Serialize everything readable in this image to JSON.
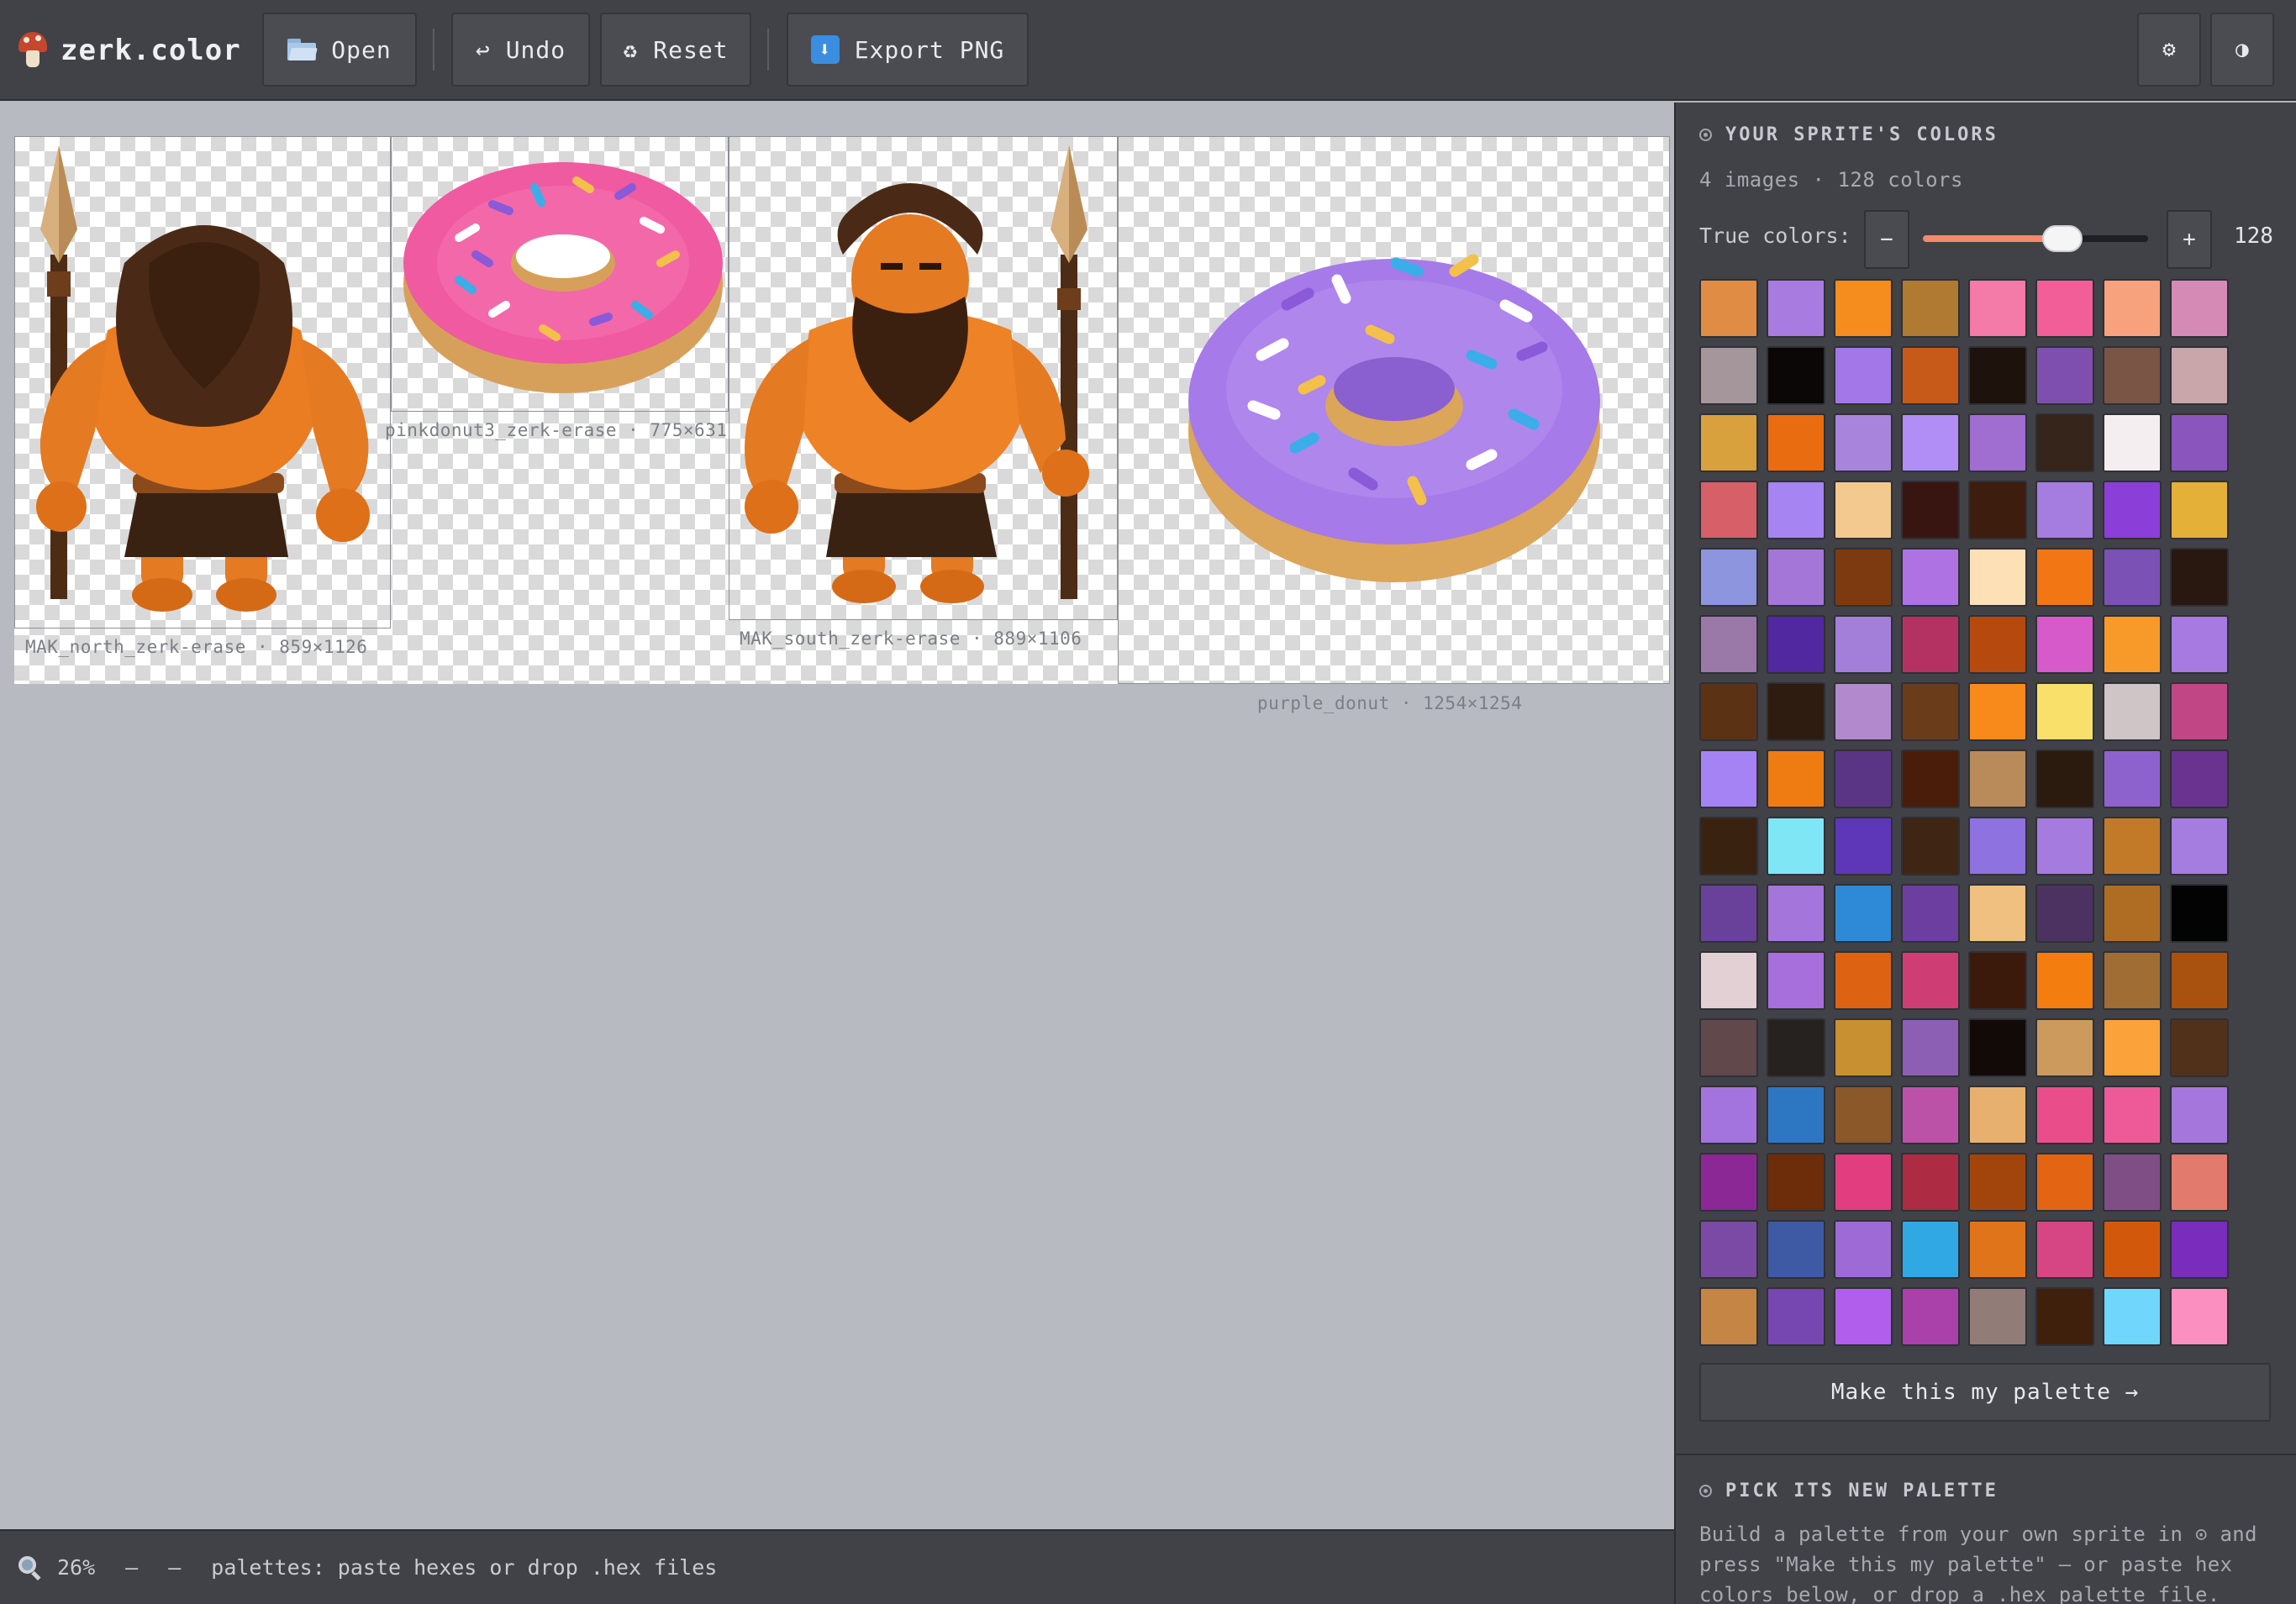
{
  "app": {
    "title": "zerk.color"
  },
  "toolbar": {
    "open_label": "Open",
    "undo_label": "Undo",
    "reset_label": "Reset",
    "export_label": "Export PNG",
    "undo_glyph": "↩",
    "reset_glyph": "♻",
    "settings_glyph": "⚙",
    "theme_glyph": "◑"
  },
  "canvas": {
    "sprites": [
      {
        "name": "MAK_north_zerk-erase",
        "caption": "MAK_north_zerk-erase · 859×1126"
      },
      {
        "name": "pinkdonut3_zerk-erase",
        "caption": "pinkdonut3_zerk-erase · 775×631"
      },
      {
        "name": "MAK_south_zerk-erase",
        "caption": "MAK_south_zerk-erase · 889×1106"
      },
      {
        "name": "purple_donut",
        "caption": "purple_donut · 1254×1254"
      }
    ]
  },
  "status": {
    "zoom": "26%",
    "dash1": "—",
    "dash2": "—",
    "hint": "palettes: paste hexes or drop .hex files"
  },
  "sidebar": {
    "colors_heading": "YOUR SPRITE'S COLORS",
    "meta": "4 images · 128 colors",
    "true_colors_label": "True colors:",
    "minus": "−",
    "plus": "+",
    "true_colors_value": "128",
    "true_colors_fraction": 0.62,
    "make_palette_label": "Make this my palette →",
    "pick_heading": "PICK ITS NEW PALETTE",
    "help_text": "Build a palette from your own sprite in ⊙ and press \"Make this my palette\" — or paste hex colors below, or drop a .hex palette file.",
    "swatches": [
      "#e08c45",
      "#a87be0",
      "#f58c1e",
      "#b07a33",
      "#f47aa8",
      "#f25e98",
      "#f7a27c",
      "#d58ab5",
      "#a5969b",
      "#0b0706",
      "#a377e8",
      "#c75a18",
      "#1d120c",
      "#7f4fb0",
      "#7a5444",
      "#c9a6aa",
      "#d9a03e",
      "#ea6c10",
      "#a884dc",
      "#b08ef5",
      "#9f6ed0",
      "#35251a",
      "#f4eef0",
      "#8a55bd",
      "#d75f67",
      "#a684f2",
      "#f3c98f",
      "#391511",
      "#3d1d0e",
      "#a57de0",
      "#8c3ed8",
      "#e4b038",
      "#8d95de",
      "#a476d8",
      "#7d3a10",
      "#ae72e3",
      "#fde0b5",
      "#f27714",
      "#7b51b5",
      "#28180f",
      "#9a78a8",
      "#5128a0",
      "#a37fda",
      "#b43262",
      "#b5490e",
      "#d65ac9",
      "#f89a2a",
      "#a67ae0",
      "#5b3314",
      "#2e1c10",
      "#b389ce",
      "#6a3c19",
      "#f88a1c",
      "#f9e06a",
      "#cfc4c6",
      "#c04686",
      "#a683f4",
      "#ee7c12",
      "#5b3585",
      "#4a1d0a",
      "#b98a5a",
      "#2b1a0e",
      "#8d62cd",
      "#6b3390",
      "#3a2210",
      "#7fe6f6",
      "#5d37b8",
      "#3f2513",
      "#8d72e0",
      "#a67be0",
      "#c27a28",
      "#a57ce0",
      "#69409a",
      "#a475da",
      "#2e8ad6",
      "#6c3e9f",
      "#efc07f",
      "#4c3260",
      "#af6d24",
      "#040303",
      "#e2d0d4",
      "#a66fdc",
      "#dd6312",
      "#ce3e75",
      "#3b1a0c",
      "#f47d10",
      "#a06d35",
      "#a9520f",
      "#61484b",
      "#26221f",
      "#c99032",
      "#8c5fb5",
      "#120a07",
      "#cd9a5d",
      "#fca23a",
      "#52311a",
      "#a374dd",
      "#2d77c2",
      "#8b582a",
      "#bc52a8",
      "#e8b06e",
      "#ea4e8a",
      "#ee5a98",
      "#a577dd",
      "#8b2895",
      "#6e2d0a",
      "#e23d7f",
      "#ad2c43",
      "#a2450c",
      "#e36514",
      "#7f4e85",
      "#e27a6d",
      "#7b4aa5",
      "#3f5aa4",
      "#9e6ad6",
      "#30a8e4",
      "#df741a",
      "#d64685",
      "#d2590b",
      "#7a2cbd",
      "#c48545",
      "#7647b0",
      "#b05eeb",
      "#aa40a9",
      "#917c78",
      "#3e200c",
      "#70d6fc",
      "#fa8fc0"
    ]
  }
}
